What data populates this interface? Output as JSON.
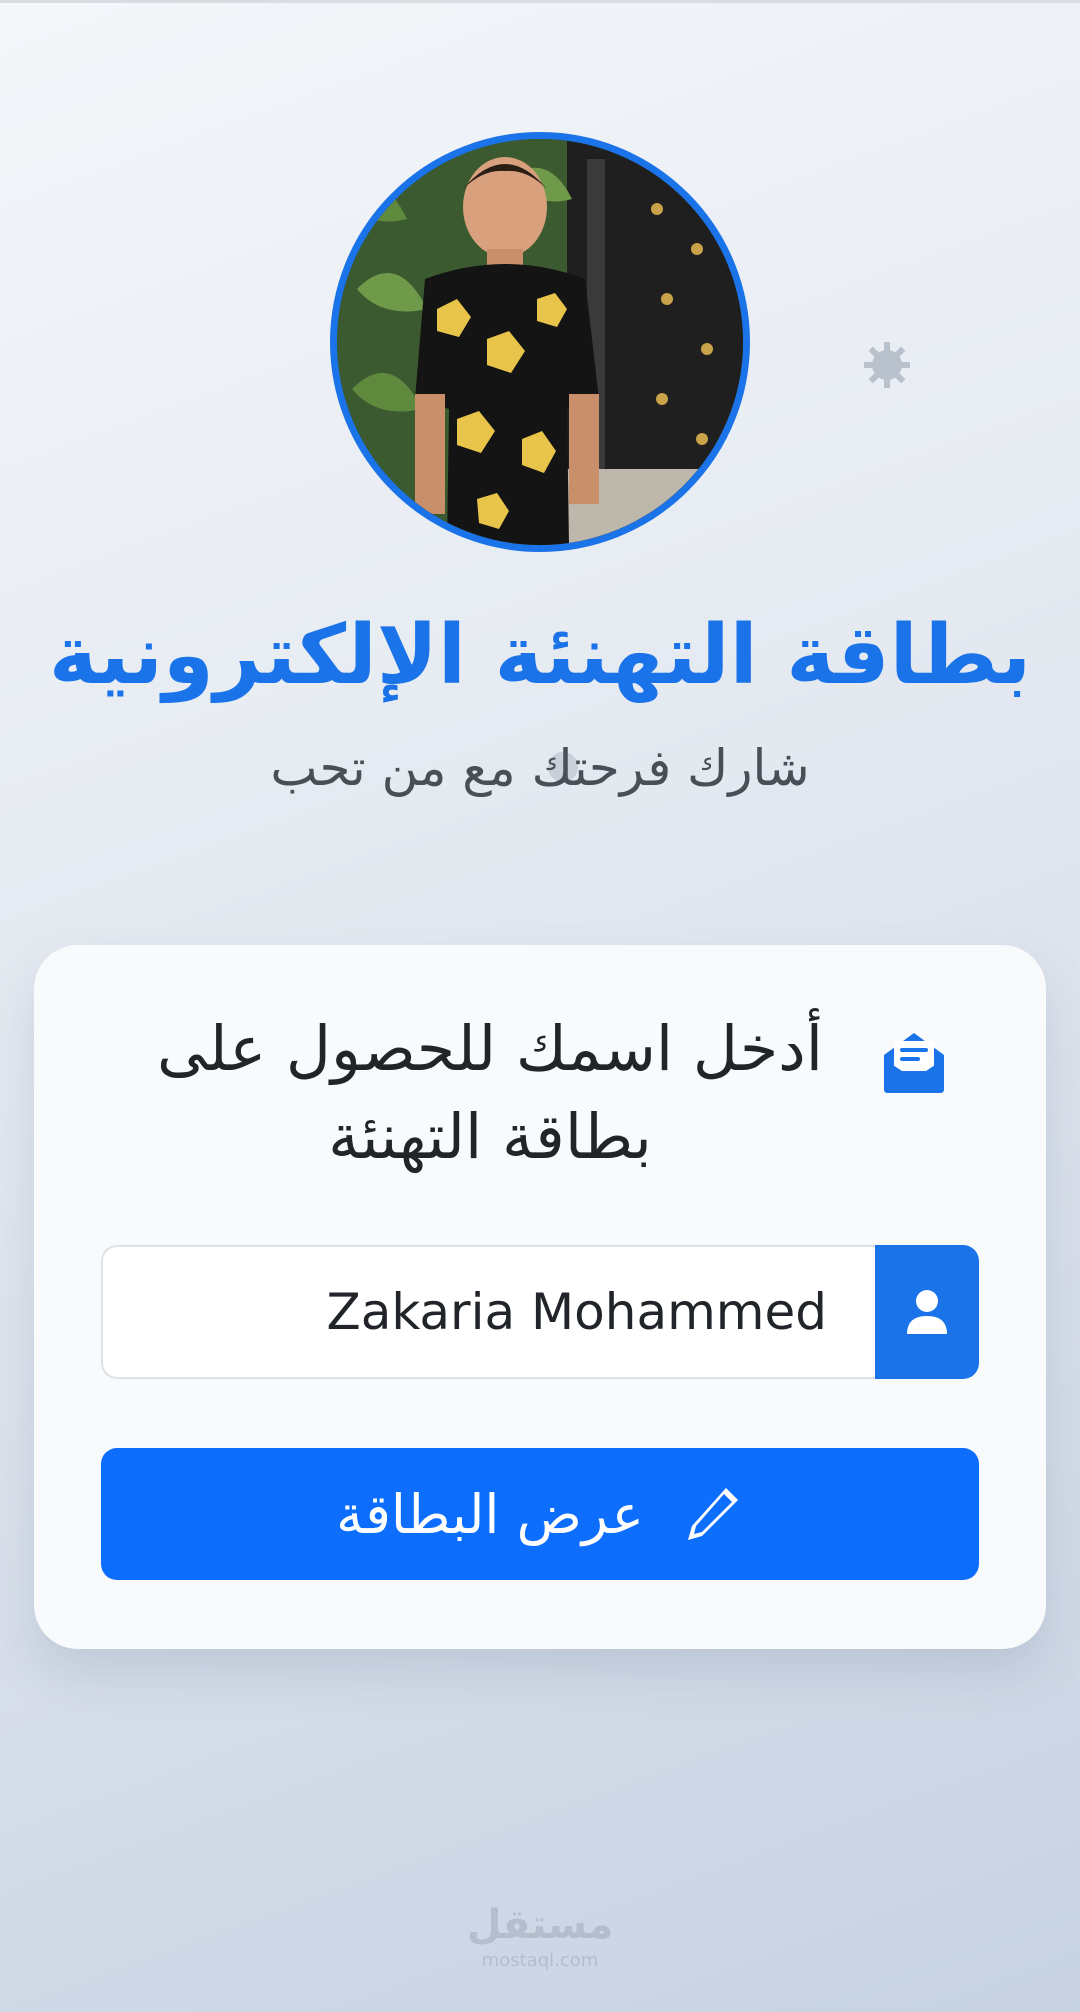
{
  "header": {
    "title": "بطاقة التهنئة الإلكترونية",
    "subtitle": "شارك فرحتك مع من تحب"
  },
  "profile": {
    "avatar_description": "profile-photo"
  },
  "card": {
    "heading": "أدخل اسمك للحصول على بطاقة التهنئة",
    "heading_icon": "envelope-open-icon",
    "name_input": {
      "value": "Zakaria Mohammed",
      "icon": "user-icon"
    },
    "submit_button": {
      "label": "عرض البطاقة",
      "icon": "pencil-icon"
    }
  },
  "watermark": {
    "logo": "مستقل",
    "url": "mostaql.com"
  },
  "colors": {
    "accent": "#1a73e8",
    "button": "#0d6efd",
    "text_dark": "#212529",
    "text_muted": "#4a4f57",
    "card_bg": "#f9fafc"
  }
}
